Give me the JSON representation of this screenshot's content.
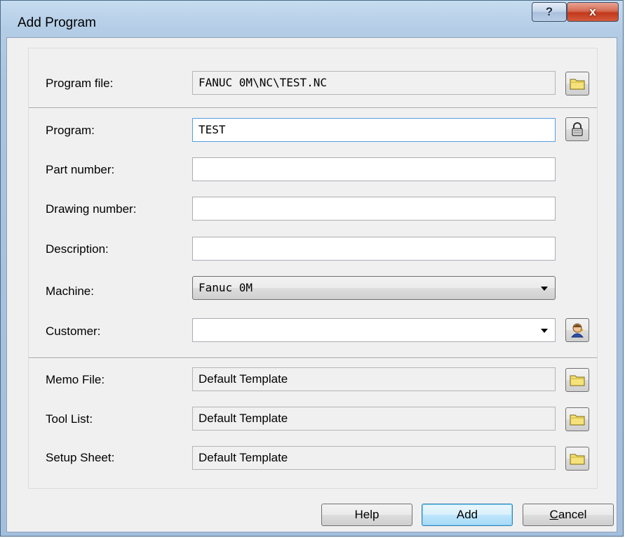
{
  "window": {
    "title": "Add Program",
    "help_glyph": "?",
    "close_glyph": "x"
  },
  "form": {
    "program_file": {
      "label": "Program file:",
      "value": "FANUC 0M\\NC\\TEST.NC",
      "icon": "folder-icon"
    },
    "program": {
      "label": "Program:",
      "value": "TEST",
      "icon": "lock-icon"
    },
    "part_number": {
      "label": "Part number:",
      "value": ""
    },
    "drawing_number": {
      "label": "Drawing number:",
      "value": ""
    },
    "description": {
      "label": "Description:",
      "value": ""
    },
    "machine": {
      "label": "Machine:",
      "value": "Fanuc 0M"
    },
    "customer": {
      "label": "Customer:",
      "value": "",
      "icon": "customer-icon"
    },
    "memo_file": {
      "label": "Memo File:",
      "value": "Default Template",
      "icon": "folder-icon"
    },
    "tool_list": {
      "label": "Tool List:",
      "value": "Default Template",
      "icon": "folder-icon"
    },
    "setup_sheet": {
      "label": "Setup Sheet:",
      "value": "Default Template",
      "icon": "folder-icon"
    }
  },
  "buttons": {
    "help": "Help",
    "add": "Add",
    "cancel_first": "C",
    "cancel_rest": "ancel"
  },
  "colors": {
    "titlebar": "#b4cde6",
    "close_button": "#c2391b",
    "dialog_bg": "#f0f0f0",
    "focus_border": "#569de5"
  }
}
